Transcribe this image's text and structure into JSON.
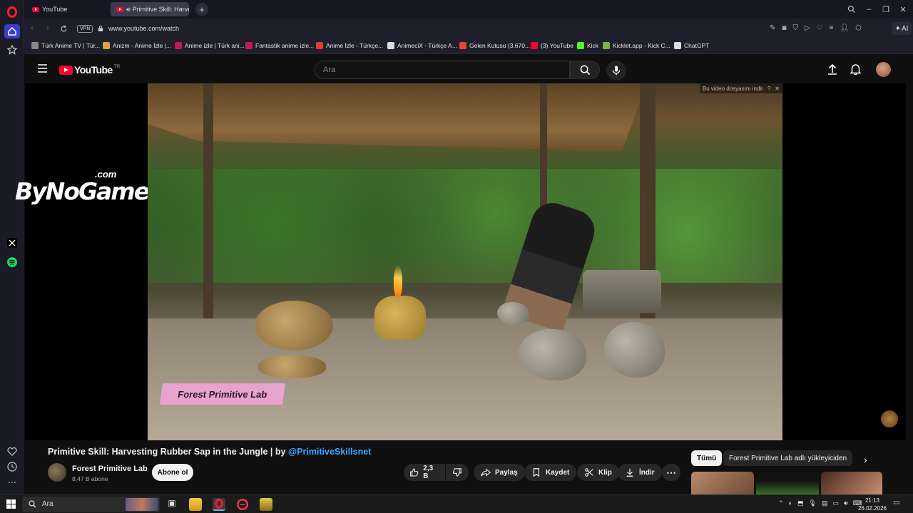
{
  "browser": {
    "tabs": [
      {
        "label": "YouTube",
        "active": false
      },
      {
        "label": "Primitive Skill: Harvest",
        "active": true
      }
    ],
    "vpn_label": "VPN",
    "url": "www.youtube.com/watch",
    "ai_label": "AI",
    "bookmarks": [
      {
        "label": "Türk Anime TV | Tür...",
        "icon_color": "#888888"
      },
      {
        "label": "Anizm - Anime İzle |...",
        "icon_color": "#d9a441"
      },
      {
        "label": "Anime izle | Türk ani...",
        "icon_color": "#c2185b"
      },
      {
        "label": "Fantastik anime izle...",
        "icon_color": "#c2185b"
      },
      {
        "label": "Anime İzle - Türkçe...",
        "icon_color": "#e53935"
      },
      {
        "label": "AnimeciX - Türkçe A...",
        "icon_color": "#dddddd"
      },
      {
        "label": "Gelen Kutusu (3.670...",
        "icon_color": "#ea4335"
      },
      {
        "label": "(3) YouTube",
        "icon_color": "#ff0033"
      },
      {
        "label": "Kick",
        "icon_color": "#53fc18"
      },
      {
        "label": "Kicklet.app - Kick C...",
        "icon_color": "#7cb342"
      },
      {
        "label": "ChatGPT",
        "icon_color": "#dddddd"
      }
    ]
  },
  "youtube": {
    "logo_text": "YouTube",
    "region": "TR",
    "search_placeholder": "Ara",
    "video": {
      "title": "Primitive Skill: Harvesting Rubber Sap in the Jungle | by ",
      "handle": "@PrimitiveSkillsnet",
      "watermark": "Forest Primitive Lab",
      "download_note": "Bu video dosyasını indir",
      "overlay_brand": "ByNoGame",
      "overlay_brand_suffix": ".com"
    },
    "channel": {
      "name": "Forest Primitive Lab",
      "subscribers": "8,47 B abone",
      "subscribe_label": "Abone ol"
    },
    "actions": {
      "likes": "2,3 B",
      "share": "Paylaş",
      "save": "Kaydet",
      "clip": "Klip",
      "download": "İndir"
    },
    "chips": [
      "Tümü",
      "Forest Primitive Lab adlı yükleyiciden"
    ]
  },
  "taskbar": {
    "search_placeholder": "Ara",
    "time": "21:13",
    "date": "26.02.2026"
  },
  "colors": {
    "opera_red": "#ff1b2d",
    "youtube_red": "#ff0033",
    "link_blue": "#3ea6ff",
    "watermark_pink": "#e8a3cf"
  }
}
